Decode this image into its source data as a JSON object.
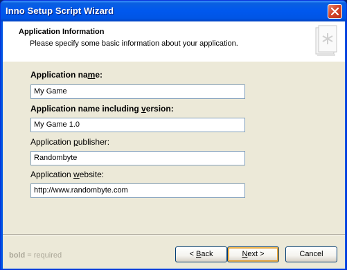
{
  "window": {
    "title": "Inno Setup Script Wizard"
  },
  "header": {
    "title": "Application Information",
    "subtitle": "Please specify some basic information about your application."
  },
  "fields": [
    {
      "label_pre": "Application na",
      "label_access": "m",
      "label_post": "e:",
      "bold": true,
      "value": "My Game"
    },
    {
      "label_pre": "Application name including ",
      "label_access": "v",
      "label_post": "ersion:",
      "bold": true,
      "value": "My Game 1.0"
    },
    {
      "label_pre": "Application ",
      "label_access": "p",
      "label_post": "ublisher:",
      "bold": false,
      "value": "Randombyte"
    },
    {
      "label_pre": "Application ",
      "label_access": "w",
      "label_post": "ebsite:",
      "bold": false,
      "value": "http://www.randombyte.com"
    }
  ],
  "footer": {
    "legend_bold": "bold",
    "legend_rest": " = required",
    "back": {
      "pre": "< ",
      "access": "B",
      "post": "ack"
    },
    "next": {
      "pre": "",
      "access": "N",
      "post": "ext >"
    },
    "cancel": "Cancel"
  },
  "colors": {
    "titlebar": "#0058ee",
    "dialog_bg": "#ece9d8",
    "close_button": "#d2462a"
  }
}
